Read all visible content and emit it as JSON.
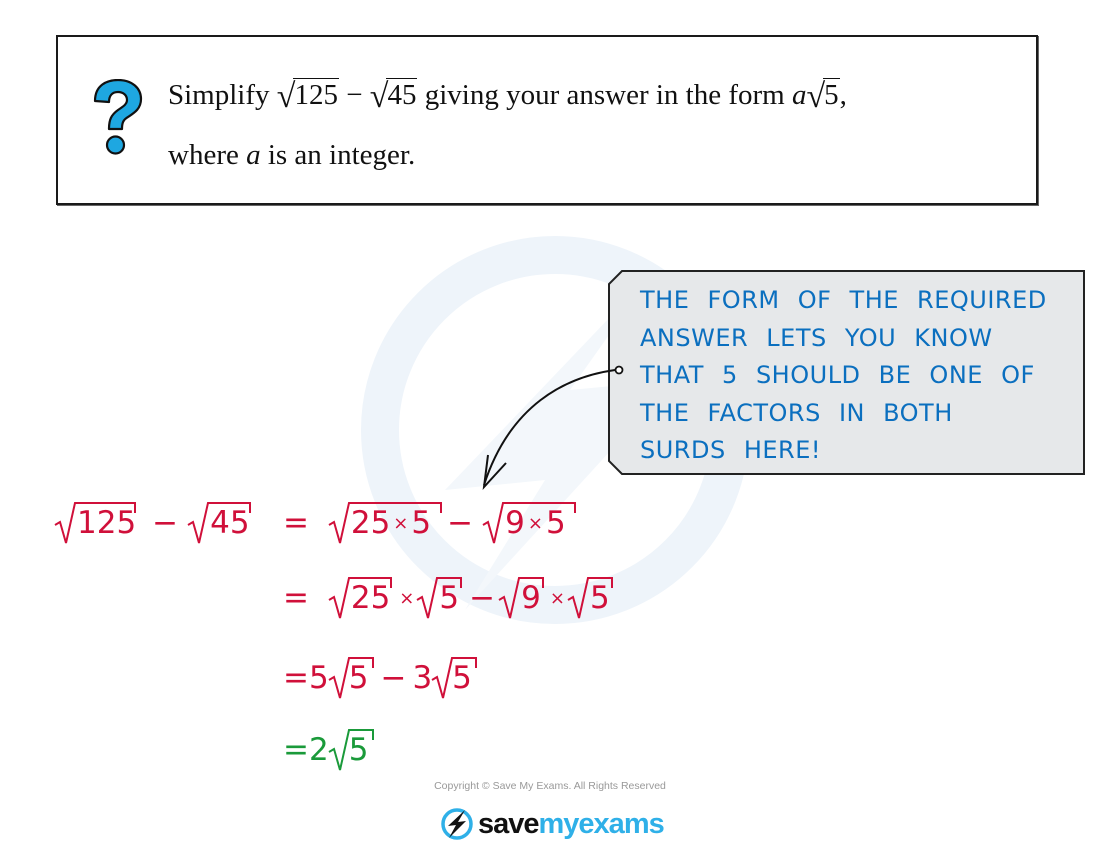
{
  "question": {
    "icon": "question-mark-icon",
    "line1_prefix": "Simplify ",
    "radicand_1": "125",
    "minus": " − ",
    "radicand_2": "45",
    "line1_mid": " giving your answer in the form ",
    "form_var": "a",
    "form_radicand": "5",
    "line1_suffix": ",",
    "line2_prefix": "where ",
    "line2_var": "a",
    "line2_suffix": " is an integer."
  },
  "note": {
    "lines": [
      "THE FORM OF THE REQUIRED",
      "ANSWER LETS YOU KNOW",
      "THAT 5 SHOULD BE ONE OF",
      "THE FACTORS IN BOTH",
      "SURDS HERE!"
    ]
  },
  "working": {
    "line1": {
      "lhs_a": "125",
      "lhs_b": "45",
      "eq": "=",
      "rhs_a1": "25",
      "rhs_a2": "5",
      "rhs_b1": "9",
      "rhs_b2": "5"
    },
    "line2": {
      "eq": "=",
      "a": "25",
      "b": "5",
      "c": "9",
      "d": "5"
    },
    "line3": {
      "eq": "=",
      "coef1": "5",
      "rad1": "5",
      "coef2": "3",
      "rad2": "5"
    },
    "line4": {
      "eq": "=",
      "coef": "2",
      "rad": "5"
    },
    "minus": "−",
    "times": "×"
  },
  "colors": {
    "working": "#d0103a",
    "answer": "#1a9a3a",
    "note_text": "#0b6fbf",
    "icon": "#1ea7e1"
  },
  "footer": {
    "copyright": "Copyright © Save My Exams. All Rights Reserved",
    "logo_save": "save",
    "logo_my": "myexams"
  }
}
